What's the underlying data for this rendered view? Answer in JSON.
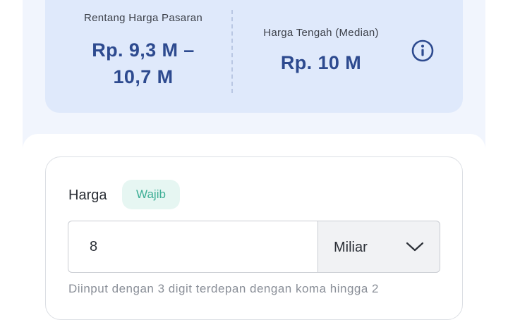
{
  "market_price": {
    "range_label": "Rentang Harga Pasaran",
    "range_value_line1": "Rp. 9,3 M –",
    "range_value_line2": "10,7 M",
    "median_label": "Harga Tengah (Median)",
    "median_value": "Rp. 10 M",
    "info_icon": "info-circle-icon"
  },
  "price_field": {
    "label": "Harga",
    "required_badge": "Wajib",
    "value": "8",
    "unit_selected": "Miliar",
    "unit_icon": "chevron-down-icon",
    "helper_text": "Diinput dengan 3 digit terdepan dengan koma hingga 2"
  },
  "colors": {
    "accent_text": "#2d4a8f",
    "card_background": "#dfe9fb",
    "badge_text": "#3cae95",
    "badge_background": "#e6f6f2"
  }
}
